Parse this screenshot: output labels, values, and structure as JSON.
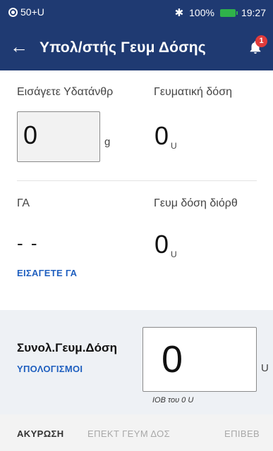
{
  "status_bar": {
    "left_text": "50+U",
    "bluetooth_symbol": "✱",
    "battery_percent": "100%",
    "time": "19:27",
    "battery_color": "#2fb24a"
  },
  "app_bar": {
    "title": "Υπολ/στής Γευμ Δόσης",
    "back_symbol": "←",
    "notification_count": "1",
    "background_color": "#1f3a72"
  },
  "carbs": {
    "label": "Εισάγετε Υδατάνθρ",
    "value": "0",
    "unit": "g"
  },
  "meal_dose": {
    "label": "Γευματική δόση",
    "value": "0",
    "unit": "U"
  },
  "bg": {
    "label": "ΓΑ",
    "value": "- -",
    "enter_link": "ΕΙΣΑΓΕΤΕ ΓΑ"
  },
  "correction_dose": {
    "label": "Γευμ δόση διόρθ",
    "value": "0",
    "unit": "U"
  },
  "total": {
    "label": "Συνολ.Γευμ.Δόση",
    "calculations_link": "ΥΠΟΛΟΓΙΣΜΟΙ",
    "value": "0",
    "unit": "U",
    "iob_text": "IOB του 0 U"
  },
  "footer": {
    "cancel": "ΑΚΥΡΩΣΗ",
    "extend": "ΕΠΕΚΤ ΓΕΥΜ ΔΟΣ",
    "confirm": "ΕΠΙΒΕΒ"
  },
  "icons": [
    "pod-icon",
    "bluetooth-icon",
    "battery-icon",
    "back-arrow-icon",
    "bell-icon"
  ]
}
